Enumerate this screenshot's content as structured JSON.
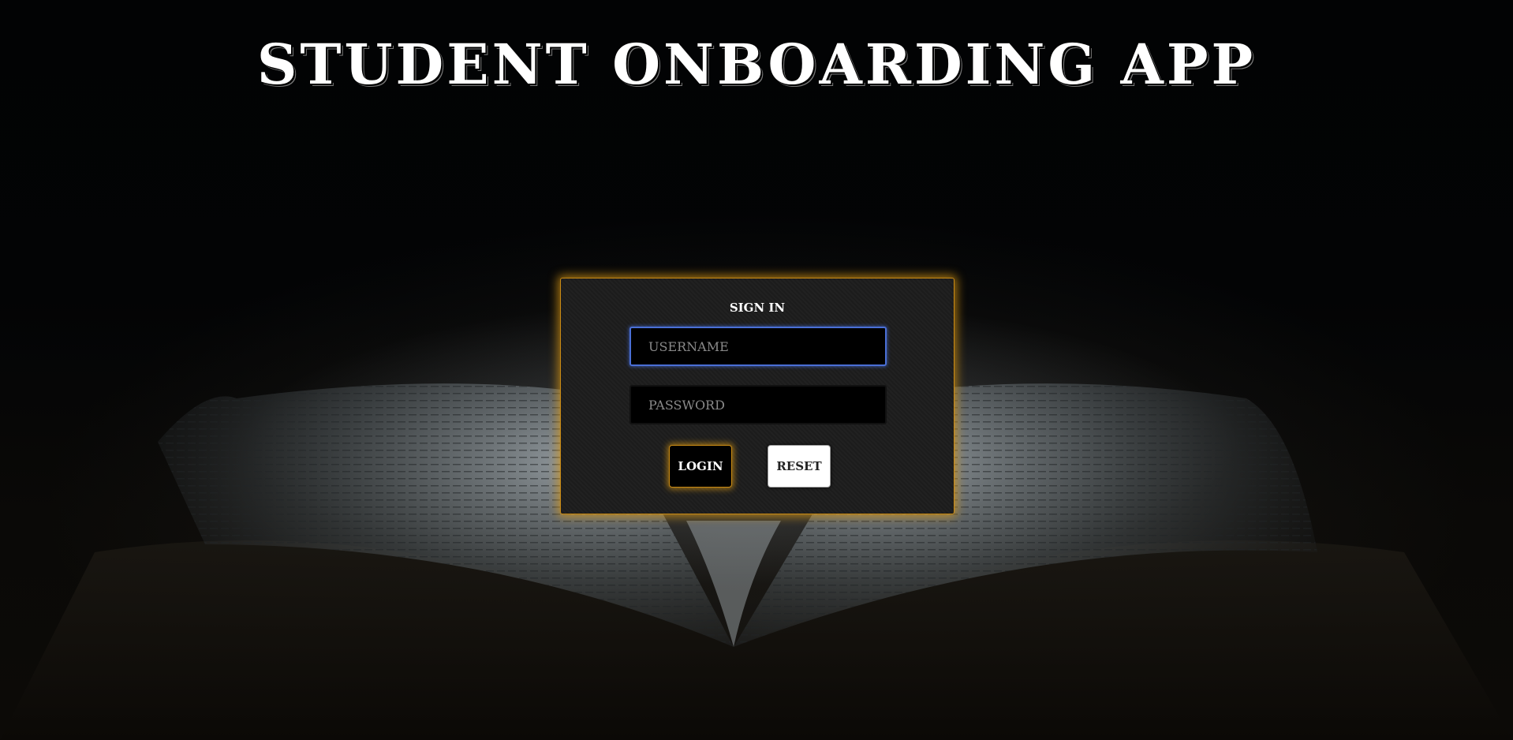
{
  "app": {
    "title": "STUDENT ONBOARDING APP"
  },
  "login_form": {
    "heading": "SIGN IN",
    "username": {
      "value": "",
      "placeholder": "USERNAME"
    },
    "password": {
      "value": "",
      "placeholder": "PASSWORD"
    },
    "login_label": "LOGIN",
    "reset_label": "RESET"
  },
  "colors": {
    "accent_glow": "#c98a14",
    "focus_border": "#4a6fd6",
    "background": "#000000"
  }
}
